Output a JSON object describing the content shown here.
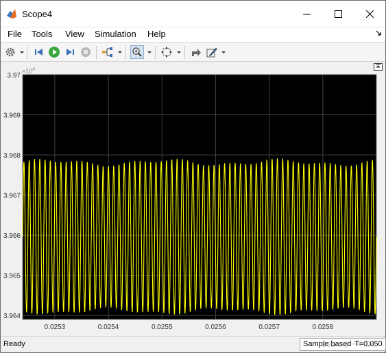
{
  "window": {
    "title": "Scope4",
    "controls": [
      "minimize",
      "maximize",
      "close"
    ]
  },
  "menu": {
    "items": [
      "File",
      "Tools",
      "View",
      "Simulation",
      "Help"
    ]
  },
  "toolbar": {
    "icons": [
      "gear-icon",
      "step-back-icon",
      "run-icon",
      "step-forward-icon",
      "stop-icon",
      "signal-select-icon",
      "zoom-in-icon",
      "autoscale-icon",
      "highlight-icon",
      "style-icon"
    ]
  },
  "plot": {
    "exponent_base": "×10",
    "exponent_power": "4",
    "y_ticks": [
      "3.97",
      "3.969",
      "3.968",
      "3.967",
      "3.966",
      "3.965",
      "3.964"
    ],
    "x_ticks": [
      "0.0253",
      "0.0254",
      "0.0255",
      "0.0256",
      "0.0257",
      "0.0258"
    ],
    "background": "#000000",
    "grid_color": "#404040",
    "line_color": "#ffff00"
  },
  "chart_data": {
    "type": "line",
    "x_range": [
      0.02524,
      0.0259
    ],
    "ylim": [
      39639.0,
      39700.0
    ],
    "y_exponent": 4,
    "xticks": [
      0.0253,
      0.0254,
      0.0255,
      0.0256,
      0.0257,
      0.0258
    ],
    "yticks": [
      3.964,
      3.965,
      3.966,
      3.967,
      3.968,
      3.969,
      3.97
    ],
    "series": [
      {
        "color": "#ffff00",
        "kind": "oscillation",
        "cycles": 67,
        "max": 39678.2,
        "min": 39641.0
      }
    ],
    "grid": true
  },
  "status": {
    "left": "Ready",
    "mode": "Sample based",
    "time": "T=0.050",
    "watermark": "CSDN @一叶知秋"
  }
}
